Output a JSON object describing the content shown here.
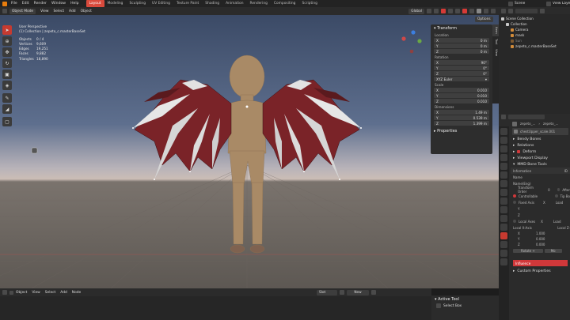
{
  "menu": [
    "File",
    "Edit",
    "Render",
    "Window",
    "Help"
  ],
  "workspaces": [
    {
      "label": "Layout",
      "active": true
    },
    {
      "label": "Modeling"
    },
    {
      "label": "Sculpting"
    },
    {
      "label": "UV Editing"
    },
    {
      "label": "Texture Paint"
    },
    {
      "label": "Shading"
    },
    {
      "label": "Animation"
    },
    {
      "label": "Rendering"
    },
    {
      "label": "Compositing"
    },
    {
      "label": "Scripting"
    }
  ],
  "scene": "Scene",
  "view_layer": "View Layer",
  "viewport_header": {
    "mode": "Object Mode",
    "menus": [
      "View",
      "Select",
      "Add",
      "Object"
    ],
    "transform_space": "Global",
    "options": "Options"
  },
  "viewport_info": {
    "title": "User Perspective",
    "collection": "(1) Collection | zepeto_c.masterBaseSet",
    "stats": [
      {
        "k": "Objects",
        "v": "0 / 4"
      },
      {
        "k": "Vertices",
        "v": "9,609"
      },
      {
        "k": "Edges",
        "v": "19,251"
      },
      {
        "k": "Faces",
        "v": "9,882"
      },
      {
        "k": "Triangles",
        "v": "18,890"
      }
    ]
  },
  "transform": {
    "title": "Transform",
    "location_label": "Location",
    "location": [
      {
        "axis": "X",
        "val": "0 m"
      },
      {
        "axis": "Y",
        "val": "0 m"
      },
      {
        "axis": "Z",
        "val": "0 m"
      }
    ],
    "rotation_label": "Rotation",
    "rotation": [
      {
        "axis": "X",
        "val": "90°"
      },
      {
        "axis": "Y",
        "val": "0°"
      },
      {
        "axis": "Z",
        "val": "0°"
      }
    ],
    "rotation_mode": "XYZ Euler",
    "scale_label": "Scale",
    "scale": [
      {
        "axis": "X",
        "val": "0.010"
      },
      {
        "axis": "Y",
        "val": "0.010"
      },
      {
        "axis": "Z",
        "val": "0.010"
      }
    ],
    "dimensions_label": "Dimensions",
    "dimensions": [
      {
        "axis": "X",
        "val": "1.49 m"
      },
      {
        "axis": "Y",
        "val": "0.539 m"
      },
      {
        "axis": "Z",
        "val": "1.399 m"
      }
    ],
    "properties": "Properties"
  },
  "npanel_tabs": [
    "Item",
    "Tool",
    "View"
  ],
  "outliner": {
    "items": [
      {
        "label": "Scene Collection",
        "indent": 0
      },
      {
        "label": "Collection",
        "indent": 1
      },
      {
        "label": "Camera",
        "indent": 2
      },
      {
        "label": "mask",
        "indent": 2
      },
      {
        "label": "Sun",
        "indent": 2
      },
      {
        "label": "zepeto_c.masterBaseSet",
        "indent": 2
      }
    ]
  },
  "properties": {
    "breadcrumb1": "zepeto_...",
    "breadcrumb2": "zepeto_...",
    "bone_name": "chestUpper_scale.001",
    "sections": [
      "Bendy Bones",
      "Relations",
      "Deform",
      "Viewport Display",
      "MMD Bone Tools"
    ],
    "information": "Information",
    "id": "ID",
    "name": "Name",
    "name_eng": "Name(Eng)",
    "transform_order": "Transform Order",
    "transform_order_value": "0",
    "after_dynamics": "After",
    "controllable": "Controllable",
    "tip_bone": "Tip Bo",
    "fixed_axis": "Fixed Axis",
    "local_axes": "Local Axes",
    "local_x_label": "Local X-Axis",
    "local_z_label": "Local Z-",
    "local_x": [
      {
        "axis": "X",
        "val": "1.000"
      },
      {
        "axis": "Y",
        "val": "0.000"
      },
      {
        "axis": "Z",
        "val": "0.000"
      }
    ],
    "load": "Load",
    "x": "X",
    "y": "Y",
    "z": "Z",
    "rotate": "Rotate +",
    "move": "Mo",
    "influence": "Influence",
    "custom_props": "Custom Properties"
  },
  "timeline_header": {
    "mode_menus": [
      "Object",
      "View",
      "Select",
      "Add",
      "Node"
    ],
    "slot": "Slot",
    "new": "New"
  },
  "active_tool": {
    "title": "Active Tool",
    "tool": "Select Box"
  }
}
